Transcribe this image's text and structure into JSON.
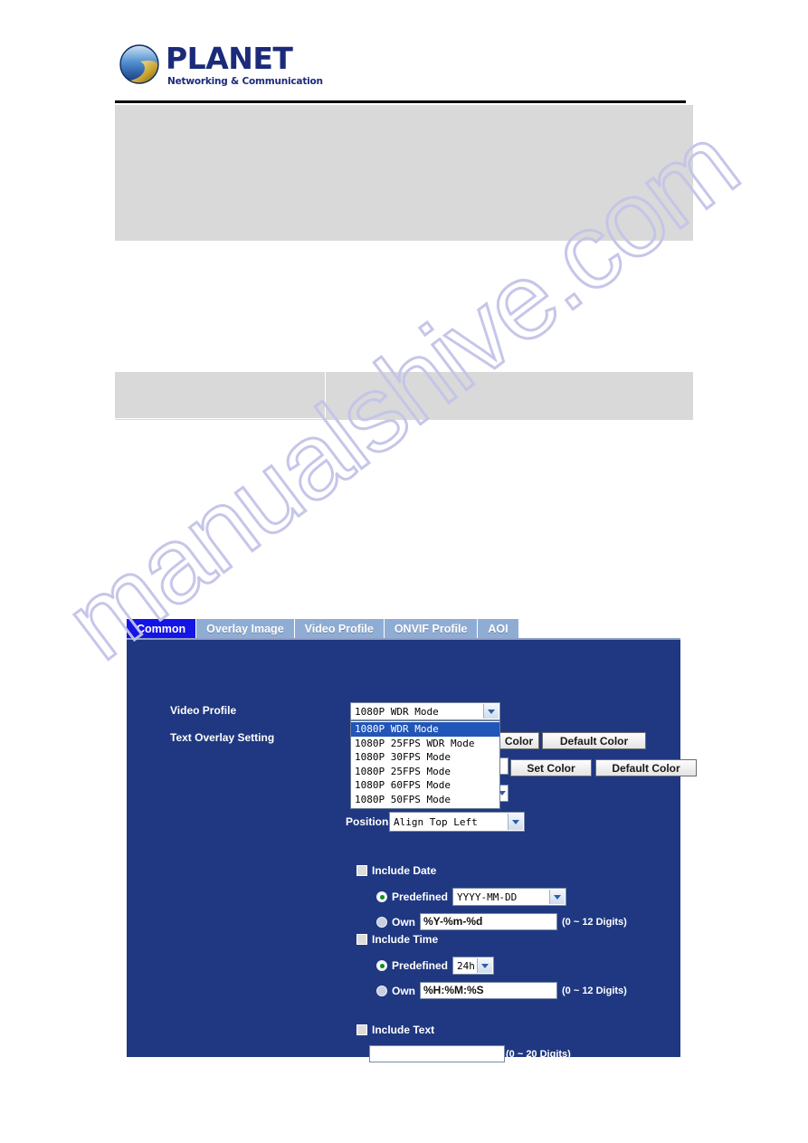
{
  "header": {
    "brand": "PLANET",
    "tagline": "Networking & Communication",
    "logo_icon": "planet-globe-logo"
  },
  "watermark": {
    "text": "manualshive.com"
  },
  "camera_ui": {
    "tabs": [
      {
        "label": "Common",
        "active": true
      },
      {
        "label": "Overlay Image",
        "active": false
      },
      {
        "label": "Video Profile",
        "active": false
      },
      {
        "label": "ONVIF Profile",
        "active": false
      },
      {
        "label": "AOI",
        "active": false
      }
    ],
    "labels": {
      "video_profile": "Video Profile",
      "text_overlay_setting": "Text Overlay Setting",
      "position": "Position"
    },
    "video_profile": {
      "selected": "1080P WDR Mode",
      "expanded": true,
      "options": [
        "1080P WDR Mode",
        "1080P 25FPS WDR Mode",
        "1080P 30FPS Mode",
        "1080P 25FPS Mode",
        "1080P 60FPS Mode",
        "1080P 50FPS Mode"
      ]
    },
    "buttons": {
      "color_row1_partial": "Color",
      "default_color_row1": "Default Color",
      "set_color_row2": "Set Color",
      "default_color_row2": "Default Color"
    },
    "position": {
      "selected": "Align Top Left"
    },
    "include_date": {
      "checkbox_label": "Include Date",
      "checked": false,
      "predefined_label": "Predefined",
      "predefined_selected": true,
      "predefined_value": "YYYY-MM-DD",
      "own_label": "Own",
      "own_selected": false,
      "own_value": "%Y-%m-%d",
      "hint": "(0 ~ 12 Digits)"
    },
    "include_time": {
      "checkbox_label": "Include Time",
      "checked": false,
      "predefined_label": "Predefined",
      "predefined_selected": true,
      "predefined_value": "24h",
      "own_label": "Own",
      "own_selected": false,
      "own_value": "%H:%M:%S",
      "hint": "(0 ~ 12 Digits)"
    },
    "include_text": {
      "checkbox_label": "Include Text",
      "checked": false,
      "value": "",
      "hint": "(0 ~ 20 Digits)"
    }
  },
  "colors": {
    "panel_blue": "#1f3881",
    "active_tab_blue": "#1414e6",
    "inactive_tab_blue": "#8fadd4",
    "highlight_blue": "#2155b8",
    "gray_block": "#d9d9d9",
    "brand_navy": "#1b2b7a"
  }
}
